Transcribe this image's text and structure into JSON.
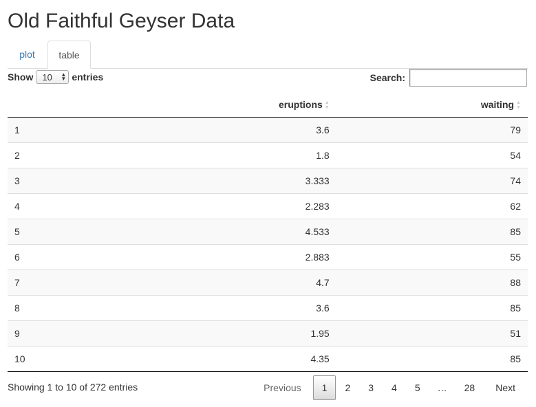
{
  "title": "Old Faithful Geyser Data",
  "tabs": [
    {
      "label": "plot",
      "active": false
    },
    {
      "label": "table",
      "active": true
    }
  ],
  "length_control": {
    "show_label": "Show",
    "selected": "10",
    "entries_label": "entries"
  },
  "search": {
    "label": "Search:",
    "value": ""
  },
  "table": {
    "columns": [
      "",
      "eruptions",
      "waiting"
    ],
    "rows": [
      {
        "index": "1",
        "eruptions": "3.6",
        "waiting": "79"
      },
      {
        "index": "2",
        "eruptions": "1.8",
        "waiting": "54"
      },
      {
        "index": "3",
        "eruptions": "3.333",
        "waiting": "74"
      },
      {
        "index": "4",
        "eruptions": "2.283",
        "waiting": "62"
      },
      {
        "index": "5",
        "eruptions": "4.533",
        "waiting": "85"
      },
      {
        "index": "6",
        "eruptions": "2.883",
        "waiting": "55"
      },
      {
        "index": "7",
        "eruptions": "4.7",
        "waiting": "88"
      },
      {
        "index": "8",
        "eruptions": "3.6",
        "waiting": "85"
      },
      {
        "index": "9",
        "eruptions": "1.95",
        "waiting": "51"
      },
      {
        "index": "10",
        "eruptions": "4.35",
        "waiting": "85"
      }
    ]
  },
  "info": "Showing 1 to 10 of 272 entries",
  "pagination": {
    "previous": "Previous",
    "pages": [
      "1",
      "2",
      "3",
      "4",
      "5"
    ],
    "ellipsis": "…",
    "last_page": "28",
    "next": "Next",
    "current": "1"
  },
  "icons": {
    "sort": "sort-both-icon",
    "select_stepper": "chevron-up-down-icon"
  }
}
